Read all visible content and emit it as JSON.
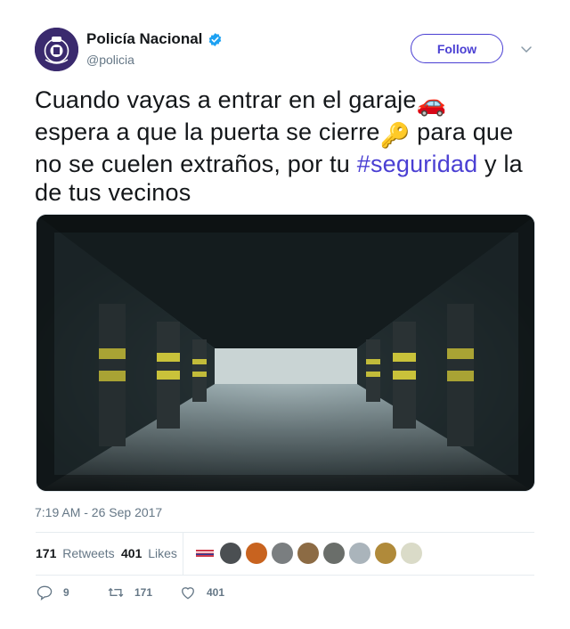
{
  "author": {
    "name": "Policía Nacional",
    "handle": "@policia",
    "verified": true,
    "avatar_color": "#3a2a6e"
  },
  "follow_label": "Follow",
  "tweet": {
    "line1": "Cuando vayas a entrar en el garaje",
    "emoji_car": "🚗",
    "line2": "espera a que la puerta se cierre",
    "emoji_key": "🔑",
    "line3a": " para que no se cuelen extraños, por tu ",
    "hashtag": "#seguridad",
    "line3b": " y la de tus vecinos"
  },
  "timestamp": "7:19 AM - 26 Sep 2017",
  "stats": {
    "retweets_count": "171",
    "retweets_label": "Retweets",
    "likes_count": "401",
    "likes_label": "Likes"
  },
  "actions": {
    "replies": "9",
    "retweets": "171",
    "likes": "401"
  },
  "colors": {
    "accent": "#4a3fd3",
    "verified": "#1da1f2",
    "muted": "#657786"
  }
}
